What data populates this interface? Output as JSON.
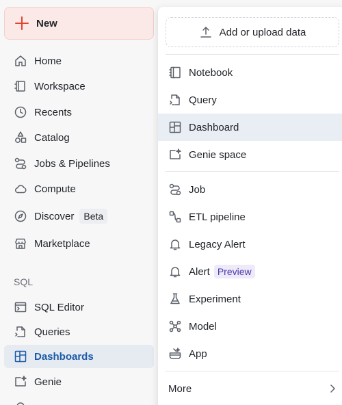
{
  "sidebar": {
    "new_label": "New",
    "items": [
      {
        "label": "Home"
      },
      {
        "label": "Workspace"
      },
      {
        "label": "Recents"
      },
      {
        "label": "Catalog"
      },
      {
        "label": "Jobs & Pipelines"
      },
      {
        "label": "Compute"
      },
      {
        "label": "Discover",
        "badge": "Beta"
      },
      {
        "label": "Marketplace"
      }
    ],
    "sql_section": "SQL",
    "sql_items": [
      {
        "label": "SQL Editor"
      },
      {
        "label": "Queries"
      },
      {
        "label": "Dashboards"
      },
      {
        "label": "Genie"
      }
    ]
  },
  "menu": {
    "upload_label": "Add or upload data",
    "group1": [
      {
        "label": "Notebook"
      },
      {
        "label": "Query"
      },
      {
        "label": "Dashboard"
      },
      {
        "label": "Genie space"
      }
    ],
    "group2": [
      {
        "label": "Job"
      },
      {
        "label": "ETL pipeline"
      },
      {
        "label": "Legacy Alert"
      },
      {
        "label": "Alert",
        "badge": "Preview"
      },
      {
        "label": "Experiment"
      },
      {
        "label": "Model"
      },
      {
        "label": "App"
      }
    ],
    "more_label": "More"
  },
  "colors": {
    "new_button_bg": "#fbe9e8",
    "new_plus": "#e5412f",
    "active_text": "#1b5aa8",
    "active_bg": "#e6ebf2",
    "preview_badge_text": "#4b3aa8"
  }
}
